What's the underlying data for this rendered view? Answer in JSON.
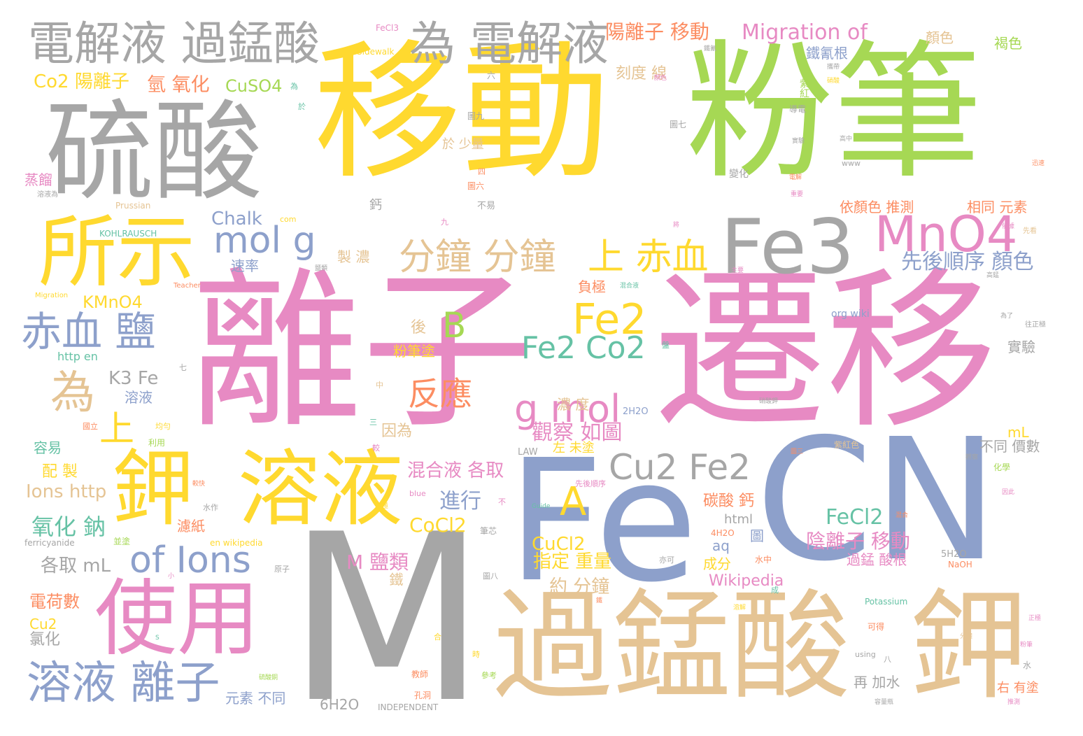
{
  "colors": {
    "gray": "#a6a6a6",
    "yellow": "#ffd92f",
    "green": "#a6d854",
    "pink": "#e78ac3",
    "blue": "#8da0cb",
    "tan": "#e5c494",
    "orange": "#fc8d62",
    "teal": "#66c2a5"
  },
  "words": [
    {
      "text": "移動",
      "color": "yellow"
    },
    {
      "text": "粉筆",
      "color": "green"
    },
    {
      "text": "離子",
      "color": "pink"
    },
    {
      "text": "遷移",
      "color": "pink"
    },
    {
      "text": "M",
      "color": "gray"
    },
    {
      "text": "Fe",
      "color": "blue"
    },
    {
      "text": "CN",
      "color": "blue"
    },
    {
      "text": "過錳酸",
      "color": "tan"
    },
    {
      "text": "鉀",
      "color": "tan"
    },
    {
      "text": "硫酸",
      "color": "gray"
    },
    {
      "text": "所示",
      "color": "yellow"
    },
    {
      "text": "使用",
      "color": "pink"
    },
    {
      "text": "溶液",
      "color": "yellow"
    },
    {
      "text": "鉀",
      "color": "yellow"
    },
    {
      "text": "Fe3",
      "color": "gray"
    },
    {
      "text": "MnO4",
      "color": "pink"
    },
    {
      "text": "電解液 過錳酸",
      "color": "gray"
    },
    {
      "text": "為 電解液",
      "color": "gray"
    },
    {
      "text": "溶液 離子",
      "color": "blue"
    },
    {
      "text": "赤血 鹽",
      "color": "blue"
    },
    {
      "text": "of Ions",
      "color": "blue"
    },
    {
      "text": "mol g",
      "color": "blue"
    },
    {
      "text": "分鐘 分鐘",
      "color": "tan"
    },
    {
      "text": "上 赤血",
      "color": "yellow"
    },
    {
      "text": "Fe2",
      "color": "yellow"
    },
    {
      "text": "B",
      "color": "green"
    },
    {
      "text": "Fe2 Co2",
      "color": "teal"
    },
    {
      "text": "g mol",
      "color": "pink"
    },
    {
      "text": "A",
      "color": "yellow"
    },
    {
      "text": "Cu2 Fe2",
      "color": "gray"
    },
    {
      "text": "反應",
      "color": "orange"
    },
    {
      "text": "為",
      "color": "tan"
    },
    {
      "text": "上",
      "color": "yellow"
    },
    {
      "text": "Migration of",
      "color": "pink"
    },
    {
      "text": "陽離子 移動",
      "color": "orange"
    },
    {
      "text": "先後順序 顏色",
      "color": "blue"
    },
    {
      "text": "氫 氧化",
      "color": "orange"
    },
    {
      "text": "CuSO4",
      "color": "green"
    },
    {
      "text": "Co2 陽離子",
      "color": "yellow"
    },
    {
      "text": "氧化 鈉",
      "color": "teal"
    },
    {
      "text": "FeCl2",
      "color": "teal"
    },
    {
      "text": "CoCl2",
      "color": "yellow"
    },
    {
      "text": "CuCl2",
      "color": "yellow"
    },
    {
      "text": "觀察 如圖",
      "color": "pink"
    },
    {
      "text": "混合液 各取",
      "color": "pink"
    },
    {
      "text": "進行",
      "color": "blue"
    },
    {
      "text": "陰離子 移動",
      "color": "pink"
    },
    {
      "text": "M 鹽類",
      "color": "pink"
    },
    {
      "text": "Chalk",
      "color": "blue"
    },
    {
      "text": "KMnO4",
      "color": "yellow"
    },
    {
      "text": "K3 Fe",
      "color": "gray"
    },
    {
      "text": "Ions http",
      "color": "tan"
    },
    {
      "text": "各取 mL",
      "color": "gray"
    },
    {
      "text": "Wikipedia",
      "color": "pink"
    },
    {
      "text": "碳酸 鈣",
      "color": "orange"
    },
    {
      "text": "指定 重量",
      "color": "yellow"
    },
    {
      "text": "約 分鐘",
      "color": "tan"
    },
    {
      "text": "刻度 線",
      "color": "tan"
    },
    {
      "text": "依顏色 推測",
      "color": "orange"
    },
    {
      "text": "相同 元素",
      "color": "orange"
    },
    {
      "text": "不同 價數",
      "color": "gray"
    },
    {
      "text": "電荷數",
      "color": "orange"
    },
    {
      "text": "氯化",
      "color": "gray"
    },
    {
      "text": "元素 不同",
      "color": "blue"
    },
    {
      "text": "再 加水",
      "color": "gray"
    },
    {
      "text": "右 有塗",
      "color": "orange"
    },
    {
      "text": "6H2O",
      "color": "gray"
    },
    {
      "text": "INDEPENDENT",
      "color": "gray"
    },
    {
      "text": "蒸餾",
      "color": "pink"
    },
    {
      "text": "速率",
      "color": "blue"
    },
    {
      "text": "製 濃",
      "color": "tan"
    },
    {
      "text": "因為",
      "color": "tan"
    },
    {
      "text": "容易",
      "color": "teal"
    },
    {
      "text": "配 製",
      "color": "yellow"
    },
    {
      "text": "濾紙",
      "color": "orange"
    },
    {
      "text": "Cu2",
      "color": "yellow"
    },
    {
      "text": "aq",
      "color": "blue"
    },
    {
      "text": "html",
      "color": "gray"
    },
    {
      "text": "成分",
      "color": "yellow"
    },
    {
      "text": "過錳 酸根",
      "color": "pink"
    },
    {
      "text": "mL",
      "color": "yellow"
    },
    {
      "text": "實驗",
      "color": "gray"
    },
    {
      "text": "鐵氰根",
      "color": "blue"
    },
    {
      "text": "顏色",
      "color": "tan"
    },
    {
      "text": "褐色",
      "color": "green"
    },
    {
      "text": "負極",
      "color": "orange"
    },
    {
      "text": "溶液",
      "color": "blue"
    },
    {
      "text": "http en",
      "color": "teal"
    },
    {
      "text": "FeCl3",
      "color": "pink"
    },
    {
      "text": "Prussian",
      "color": "tan"
    },
    {
      "text": "KOHLRAUSCH",
      "color": "teal"
    },
    {
      "text": "Sidewalk",
      "color": "yellow"
    },
    {
      "text": "ferricyanide",
      "color": "gray"
    },
    {
      "text": "en wikipedia",
      "color": "yellow"
    },
    {
      "text": "Potassium",
      "color": "teal"
    },
    {
      "text": "org wiki",
      "color": "blue"
    },
    {
      "text": "4H2O",
      "color": "orange"
    },
    {
      "text": "5H2O",
      "color": "gray"
    },
    {
      "text": "NaOH",
      "color": "orange"
    },
    {
      "text": "2H2O",
      "color": "blue"
    },
    {
      "text": "LAW",
      "color": "gray"
    },
    {
      "text": "blue",
      "color": "pink"
    },
    {
      "text": "using",
      "color": "gray"
    },
    {
      "text": "www",
      "color": "gray"
    },
    {
      "text": "com",
      "color": "yellow"
    },
    {
      "text": "Teacher",
      "color": "orange"
    },
    {
      "text": "Migration",
      "color": "yellow"
    },
    {
      "text": "Guide",
      "color": "teal"
    },
    {
      "text": "後",
      "color": "tan"
    },
    {
      "text": "粉筆塗",
      "color": "yellow"
    },
    {
      "text": "濃 度",
      "color": "tan"
    },
    {
      "text": "左 未塗",
      "color": "yellow"
    },
    {
      "text": "先後順序",
      "color": "pink"
    },
    {
      "text": "鐵",
      "color": "tan"
    },
    {
      "text": "於 少量",
      "color": "tan"
    },
    {
      "text": "鈣",
      "color": "gray"
    },
    {
      "text": "不易",
      "color": "gray"
    },
    {
      "text": "變化",
      "color": "gray"
    },
    {
      "text": "紫紅",
      "color": "green"
    },
    {
      "text": "導電",
      "color": "gray"
    },
    {
      "text": "紫紅色",
      "color": "tan"
    },
    {
      "text": "化學",
      "color": "green"
    },
    {
      "text": "可得",
      "color": "orange"
    },
    {
      "text": "水中",
      "color": "orange"
    },
    {
      "text": "水",
      "color": "gray"
    },
    {
      "text": "利用",
      "color": "green"
    },
    {
      "text": "並塗",
      "color": "green"
    },
    {
      "text": "國立",
      "color": "orange"
    },
    {
      "text": "均勻",
      "color": "yellow"
    },
    {
      "text": "筆芯",
      "color": "gray"
    },
    {
      "text": "水作",
      "color": "gray"
    },
    {
      "text": "原子",
      "color": "gray"
    },
    {
      "text": "亦可",
      "color": "gray"
    },
    {
      "text": "教師",
      "color": "orange"
    },
    {
      "text": "孔洞",
      "color": "orange"
    },
    {
      "text": "參考",
      "color": "green"
    },
    {
      "text": "時",
      "color": "yellow"
    },
    {
      "text": "圖",
      "color": "blue"
    },
    {
      "text": "圖七",
      "color": "gray"
    },
    {
      "text": "圖九",
      "color": "gray"
    },
    {
      "text": "圖八",
      "color": "gray"
    },
    {
      "text": "圖六",
      "color": "orange"
    },
    {
      "text": "四",
      "color": "orange"
    },
    {
      "text": "九",
      "color": "pink"
    },
    {
      "text": "六",
      "color": "gray"
    },
    {
      "text": "七",
      "color": "gray"
    },
    {
      "text": "三",
      "color": "teal"
    },
    {
      "text": "八",
      "color": "gray"
    },
    {
      "text": "為",
      "color": "teal"
    },
    {
      "text": "於",
      "color": "teal"
    },
    {
      "text": "較",
      "color": "pink"
    },
    {
      "text": "中",
      "color": "tan"
    },
    {
      "text": "成",
      "color": "teal"
    },
    {
      "text": "不",
      "color": "pink"
    },
    {
      "text": "盤",
      "color": "teal"
    },
    {
      "text": "合",
      "color": "yellow"
    },
    {
      "text": "S",
      "color": "teal"
    },
    {
      "text": "鹽類",
      "color": "gray"
    },
    {
      "text": "主要",
      "color": "pink"
    },
    {
      "text": "溶液為",
      "color": "gray"
    },
    {
      "text": "往正極",
      "color": "gray"
    },
    {
      "text": "混合液",
      "color": "teal"
    },
    {
      "text": "先看",
      "color": "tan"
    },
    {
      "text": "電極",
      "color": "yellow"
    },
    {
      "text": "鐵氰",
      "color": "gray"
    },
    {
      "text": "攜帶",
      "color": "gray"
    },
    {
      "text": "硝酸",
      "color": "yellow"
    },
    {
      "text": "溶解",
      "color": "yellow"
    },
    {
      "text": "硫酸銅",
      "color": "green"
    },
    {
      "text": "容量瓶",
      "color": "gray"
    },
    {
      "text": "電解",
      "color": "orange"
    },
    {
      "text": "推測",
      "color": "pink"
    },
    {
      "text": "混合",
      "color": "orange"
    },
    {
      "text": "顏色",
      "color": "pink"
    },
    {
      "text": "實驗",
      "color": "gray"
    },
    {
      "text": "高中",
      "color": "gray"
    },
    {
      "text": "迅速",
      "color": "orange"
    },
    {
      "text": "粉筆",
      "color": "pink"
    },
    {
      "text": "重要",
      "color": "pink"
    },
    {
      "text": "因此",
      "color": "pink"
    },
    {
      "text": "鐵",
      "color": "orange"
    },
    {
      "text": "將",
      "color": "pink"
    },
    {
      "text": "高錳",
      "color": "gray"
    },
    {
      "text": "圖三",
      "color": "orange"
    },
    {
      "text": "分鐘",
      "color": "tan"
    },
    {
      "text": "觀察",
      "color": "gray"
    },
    {
      "text": "硝酸鉀",
      "color": "gray"
    },
    {
      "text": "正極",
      "color": "pink"
    },
    {
      "text": "小",
      "color": "pink"
    },
    {
      "text": "依據",
      "color": "pink"
    },
    {
      "text": "為了",
      "color": "gray"
    },
    {
      "text": "較快",
      "color": "orange"
    },
    {
      "text": "離子",
      "color": "pink"
    },
    {
      "text": "氯化鈉",
      "color": "pink"
    },
    {
      "text": "每",
      "color": "tan"
    },
    {
      "text": "變色",
      "color": "teal"
    },
    {
      "text": "此實驗",
      "color": "green"
    }
  ]
}
